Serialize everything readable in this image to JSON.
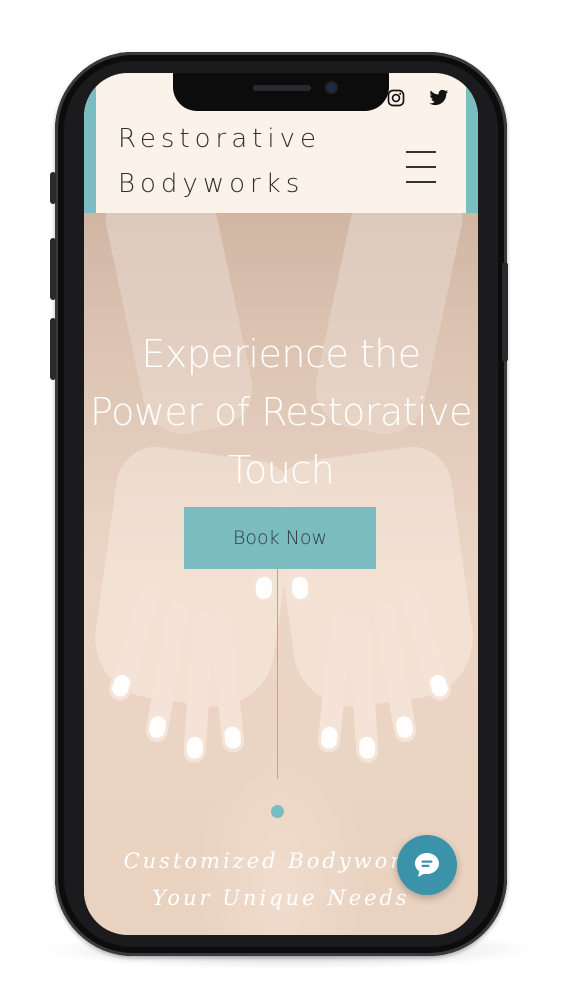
{
  "site": {
    "brand_line1": "Restorative",
    "brand_line2": "Bodyworks"
  },
  "header": {
    "menu_icon": "hamburger-menu-icon",
    "social": [
      {
        "icon": "instagram-icon"
      },
      {
        "icon": "twitter-icon"
      }
    ]
  },
  "hero": {
    "headline_line1": "Experience the",
    "headline_line2": "Power of Restorative",
    "headline_line3": "Touch",
    "cta_label": "Book Now",
    "tagline_line1": "Customized Bodywork ,",
    "tagline_line2": "Your Unique Needs"
  },
  "chat": {
    "icon": "chat-bubble-icon"
  },
  "colors": {
    "accent": "#7bbcc0",
    "header_bg": "#fbf3ea",
    "chat": "#3a93a8",
    "device": "#1b1b1d"
  }
}
